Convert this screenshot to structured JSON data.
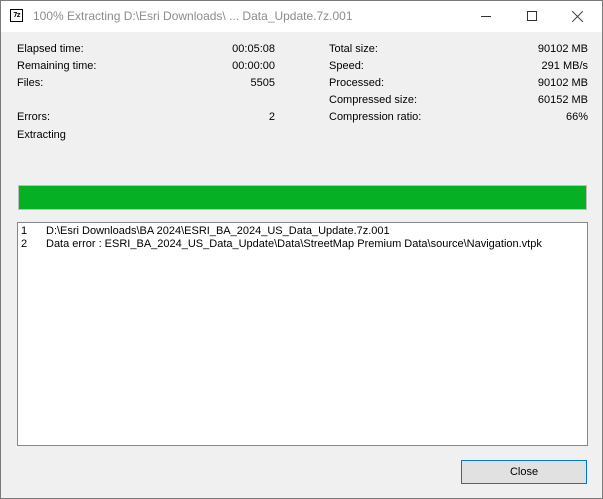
{
  "window": {
    "title": "100% Extracting D:\\Esri Downloads\\ ... Data_Update.7z.001",
    "app_icon_text": "7z"
  },
  "stats_left": [
    {
      "label": "Elapsed time:",
      "value": "00:05:08"
    },
    {
      "label": "Remaining time:",
      "value": "00:00:00"
    },
    {
      "label": "Files:",
      "value": "5505"
    },
    {
      "label": "Errors:",
      "value": "2"
    }
  ],
  "stats_right": [
    {
      "label": "Total size:",
      "value": "90102 MB"
    },
    {
      "label": "Speed:",
      "value": "291 MB/s"
    },
    {
      "label": "Processed:",
      "value": "90102 MB"
    },
    {
      "label": "Compressed size:",
      "value": "60152 MB"
    },
    {
      "label": "Compression ratio:",
      "value": "66%"
    }
  ],
  "status_text": "Extracting",
  "progress": {
    "percent": 100,
    "color": "#06b025"
  },
  "log": [
    {
      "num": "1",
      "message": "D:\\Esri Downloads\\BA 2024\\ESRI_BA_2024_US_Data_Update.7z.001"
    },
    {
      "num": "2",
      "message": "Data error : ESRI_BA_2024_US_Data_Update\\Data\\StreetMap Premium Data\\source\\Navigation.vtpk"
    }
  ],
  "buttons": {
    "close_label": "Close"
  }
}
